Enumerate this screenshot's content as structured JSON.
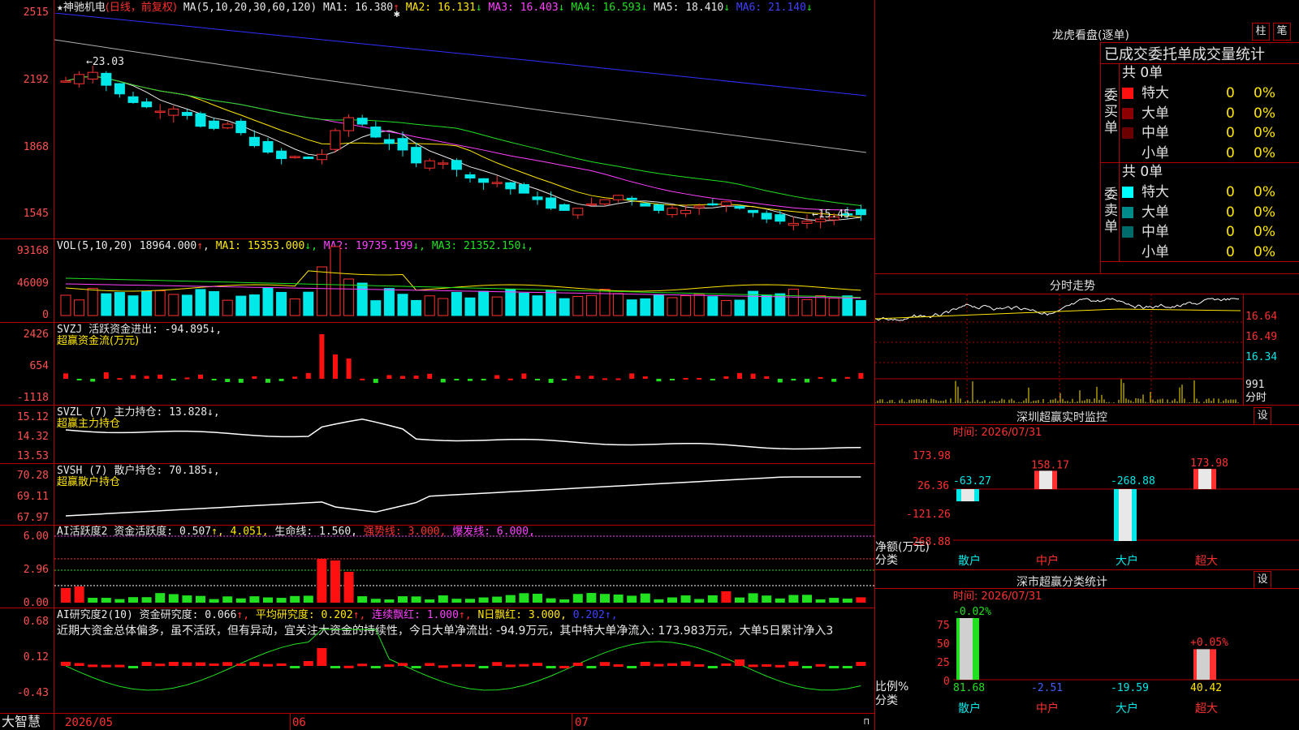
{
  "main": {
    "title": "神驰机电",
    "mode": "(日线，前复权)",
    "ma_header": "MA(5,10,20,30,60,120)",
    "ma": [
      {
        "label": "MA1:",
        "value": "16.380",
        "arrow": "↑",
        "color": "#e8e8e8"
      },
      {
        "label": "MA2:",
        "value": "16.131",
        "arrow": "↓",
        "color": "#ffe600"
      },
      {
        "label": "MA3:",
        "value": "16.403",
        "arrow": "↓",
        "color": "#ff40ff"
      },
      {
        "label": "MA4:",
        "value": "16.593",
        "arrow": "↓",
        "color": "#20e020"
      },
      {
        "label": "MA5:",
        "value": "18.410",
        "arrow": "↓",
        "color": "#e8e8e8"
      },
      {
        "label": "MA6:",
        "value": "21.140",
        "arrow": "↓",
        "color": "#4040ff"
      }
    ],
    "y_ticks": [
      "2515",
      "2192",
      "1868",
      "1545"
    ],
    "high_marker": "←23.03",
    "low_marker": "←15.45"
  },
  "vol": {
    "header": "VOL(5,10,20)",
    "value": "18964.000",
    "items": [
      {
        "label": "MA1:",
        "value": "15353.000",
        "arrow": "↓",
        "color": "#ffe600"
      },
      {
        "label": "MA2:",
        "value": "19735.199",
        "arrow": "↓",
        "color": "#ff40ff"
      },
      {
        "label": "MA3:",
        "value": "21352.150",
        "arrow": "↓",
        "color": "#20e020"
      }
    ],
    "y_ticks": [
      "93168",
      "46009",
      "0"
    ]
  },
  "svzj": {
    "line1": "SVZJ  活跃资金进出: -94.895↓,",
    "line2": "超赢资金流(万元)",
    "y_ticks": [
      "2426",
      "654",
      "-1118"
    ]
  },
  "svzl": {
    "line1": "SVZL (7) 主力持仓: 13.828↓,",
    "line2": "超赢主力持仓",
    "y_ticks": [
      "15.12",
      "14.32",
      "13.53"
    ]
  },
  "svsh": {
    "line1": "SVSH (7) 散户持仓: 70.185↓,",
    "line2": "超赢散户持仓",
    "y_ticks": [
      "70.28",
      "69.11",
      "67.97"
    ]
  },
  "ai1": {
    "parts": [
      {
        "t": "AI活跃度2 资金活跃度: 0.507",
        "c": "#e8e8e8"
      },
      {
        "t": "↑, 4.051, ",
        "c": "#ffe600"
      },
      {
        "t": "生命线: 1.560, ",
        "c": "#e8e8e8"
      },
      {
        "t": "强势线: 3.000, ",
        "c": "#ff3030"
      },
      {
        "t": "爆发线: 6.000,",
        "c": "#ff40ff"
      }
    ],
    "y_ticks": [
      "6.00",
      "2.96",
      "0.00"
    ]
  },
  "ai2": {
    "parts": [
      {
        "t": "AI研究度2(10) 资金研究度: 0.066",
        "c": "#e8e8e8"
      },
      {
        "t": "↑, ",
        "c": "#ff3030"
      },
      {
        "t": "平均研究度: 0.202",
        "c": "#ffe600"
      },
      {
        "t": "↑, ",
        "c": "#ff3030"
      },
      {
        "t": "连续飘红: 1.000",
        "c": "#ff40ff"
      },
      {
        "t": "↑, ",
        "c": "#ff3030"
      },
      {
        "t": "N日飘红: 3.000, ",
        "c": "#ffe600"
      },
      {
        "t": "0.202↑,",
        "c": "#4040ff"
      }
    ],
    "comment": "近期大资金总体偏多，虽不活跃，但有异动，宜关注大资金的持续性，今日大单净流出: -94.9万元，其中特大单净流入: 173.983万元，大单5日累计净入3",
    "y_ticks": [
      "0.68",
      "0.12",
      "-0.43"
    ]
  },
  "bottom": {
    "brand": "大智慧",
    "dates": [
      "2026/05",
      "06",
      "07"
    ]
  },
  "right": {
    "lhkp_title": "龙虎看盘(逐单)",
    "btn_zhu": "柱",
    "btn_bi": "笔",
    "stat_title": "已成交委托单成交量统计",
    "buy": {
      "side": "委买单",
      "total": "共 0单",
      "rows": [
        {
          "name": "特大",
          "qty": "0",
          "pct": "0%",
          "color": "#ff1010"
        },
        {
          "name": "大单",
          "qty": "0",
          "pct": "0%",
          "color": "#8b0000"
        },
        {
          "name": "中单",
          "qty": "0",
          "pct": "0%",
          "color": "#6b0000"
        },
        {
          "name": "小单",
          "qty": "0",
          "pct": "0%",
          "color": "#000000"
        }
      ]
    },
    "sell": {
      "side": "委卖单",
      "total": "共 0单",
      "rows": [
        {
          "name": "特大",
          "qty": "0",
          "pct": "0%",
          "color": "#00ffff"
        },
        {
          "name": "大单",
          "qty": "0",
          "pct": "0%",
          "color": "#008b8b"
        },
        {
          "name": "中单",
          "qty": "0",
          "pct": "0%",
          "color": "#006b6b"
        },
        {
          "name": "小单",
          "qty": "0",
          "pct": "0%",
          "color": "#000000"
        }
      ]
    },
    "fs_title": "分时走势",
    "fs_ticks": [
      "16.64",
      "16.49",
      "16.34",
      "991",
      "分时"
    ],
    "sz_title": "深圳超赢实时监控",
    "sz_btn": "设",
    "sz_time": "时间: 2026/07/31",
    "sz_ticks": [
      "173.98",
      "26.36",
      "-121.26",
      "-268.88"
    ],
    "sz_unit": "净额(万元)",
    "sz_cat": "分类",
    "sz_values": [
      "-63.27",
      "158.17",
      "-268.88",
      "173.98"
    ],
    "categories": [
      "散户",
      "中户",
      "大户",
      "超大"
    ],
    "ss_title": "深市超赢分类统计",
    "ss_btn": "设",
    "ss_time": "时间: 2026/07/31",
    "ss_ticks": [
      "75",
      "50",
      "25",
      "0"
    ],
    "ss_unit": "比例%",
    "ss_cat": "分类",
    "ss_top": [
      "-0.02%",
      "",
      "",
      "+0.05%"
    ],
    "ss_values": [
      "81.68",
      "-2.51",
      "-19.59",
      "40.42"
    ]
  },
  "chart_data": [
    {
      "type": "candlestick",
      "title": "神驰机电 (日线，前复权)",
      "ylim": [
        15.45,
        25.15
      ],
      "high": 23.03,
      "low": 15.45,
      "x": [
        "2026/05",
        "06",
        "07"
      ],
      "series": [
        {
          "name": "MA1",
          "last": 16.38
        },
        {
          "name": "MA2",
          "last": 16.131
        },
        {
          "name": "MA3",
          "last": 16.403
        },
        {
          "name": "MA4",
          "last": 16.593
        },
        {
          "name": "MA5",
          "last": 18.41
        },
        {
          "name": "MA6",
          "last": 21.14
        }
      ]
    },
    {
      "type": "bar",
      "title": "VOL(5,10,20)",
      "ylim": [
        0,
        93168
      ],
      "last": 18964.0
    },
    {
      "type": "bar",
      "title": "超赢资金流(万元)",
      "ylim": [
        -1118,
        2426
      ],
      "last": -94.895
    },
    {
      "type": "bar",
      "title": "深圳超赢实时监控",
      "categories": [
        "散户",
        "中户",
        "大户",
        "超大"
      ],
      "values": [
        -63.27,
        158.17,
        -268.88,
        173.98
      ],
      "ylim": [
        -268.88,
        173.98
      ]
    },
    {
      "type": "bar",
      "title": "深市超赢分类统计",
      "categories": [
        "散户",
        "中户",
        "大户",
        "超大"
      ],
      "values": [
        81.68,
        -2.51,
        -19.59,
        40.42
      ],
      "ylim": [
        0,
        75
      ]
    }
  ]
}
